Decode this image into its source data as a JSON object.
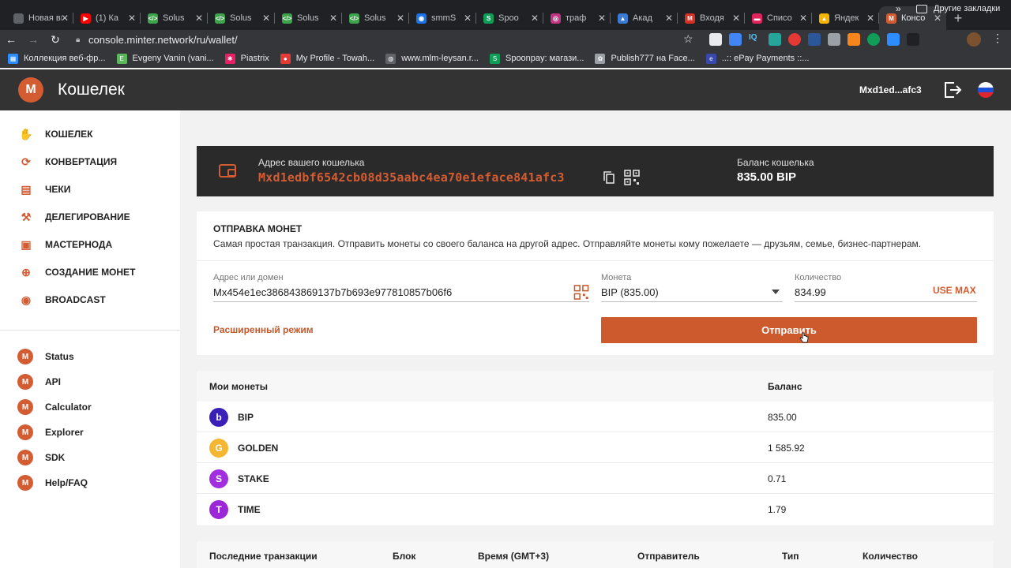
{
  "browser": {
    "tabs": [
      {
        "title": "Новая вкл",
        "color": "#5f6368",
        "glyph": ""
      },
      {
        "title": "(1) Ка",
        "color": "#ff0000",
        "glyph": "▶"
      },
      {
        "title": "Solus",
        "color": "#3fa34d",
        "glyph": "</>"
      },
      {
        "title": "Solus",
        "color": "#3fa34d",
        "glyph": "</>"
      },
      {
        "title": "Solus",
        "color": "#3fa34d",
        "glyph": "</>"
      },
      {
        "title": "Solus",
        "color": "#3fa34d",
        "glyph": "</>"
      },
      {
        "title": "smmS",
        "color": "#1a73e8",
        "glyph": "◉"
      },
      {
        "title": "Spoo",
        "color": "#0f9d58",
        "glyph": "S"
      },
      {
        "title": "траф",
        "color": "#c13584",
        "glyph": "◎"
      },
      {
        "title": "Акад",
        "color": "#3a7bd5",
        "glyph": "▲"
      },
      {
        "title": "Входя",
        "color": "#d93025",
        "glyph": "M"
      },
      {
        "title": "Списо",
        "color": "#e0245e",
        "glyph": "▬"
      },
      {
        "title": "Яндек",
        "color": "#f4b400",
        "glyph": "▲"
      },
      {
        "title": "Консо",
        "color": "#d35c32",
        "glyph": "M"
      }
    ],
    "url": "console.minter.network/ru/wallet/",
    "bookmarks": [
      {
        "label": "Коллекция веб-фр...",
        "color": "#2d8cff",
        "glyph": "▦"
      },
      {
        "label": "Evgeny Vanin (vani...",
        "color": "#5cb85c",
        "glyph": "E"
      },
      {
        "label": "Piastrix",
        "color": "#e91e63",
        "glyph": "✱"
      },
      {
        "label": "My Profile - Towah...",
        "color": "#e53935",
        "glyph": "●"
      },
      {
        "label": "www.mlm-leysan.r...",
        "color": "#5f6368",
        "glyph": "◍"
      },
      {
        "label": "Spoonpay: магази...",
        "color": "#0f9d58",
        "glyph": "S"
      },
      {
        "label": "Publish777 на Face...",
        "color": "#9aa0a6",
        "glyph": "✿"
      },
      {
        "label": "..:: ePay Payments ::...",
        "color": "#3949ab",
        "glyph": "e"
      }
    ],
    "bookmarks_more": "»",
    "bookmarks_other": "Другие закладки"
  },
  "header": {
    "logo_letter": "M",
    "title": "Кошелек",
    "address": "Mxd1ed...afc3"
  },
  "sidebar": {
    "items": [
      {
        "label": "КОШЕЛЕК",
        "icon": "wallet-hand-icon",
        "glyph": "✋"
      },
      {
        "label": "КОНВЕРТАЦИЯ",
        "icon": "convert-icon",
        "glyph": "⟳"
      },
      {
        "label": "ЧЕКИ",
        "icon": "checks-icon",
        "glyph": "▤"
      },
      {
        "label": "ДЕЛЕГИРОВАНИЕ",
        "icon": "delegate-icon",
        "glyph": "⚒"
      },
      {
        "label": "МАСТЕРНОДА",
        "icon": "masternode-icon",
        "glyph": "▣"
      },
      {
        "label": "СОЗДАНИЕ МОНЕТ",
        "icon": "create-coin-icon",
        "glyph": "⊕"
      },
      {
        "label": "BROADCAST",
        "icon": "broadcast-icon",
        "glyph": "◉"
      }
    ],
    "links": [
      {
        "label": "Status"
      },
      {
        "label": "API"
      },
      {
        "label": "Calculator"
      },
      {
        "label": "Explorer"
      },
      {
        "label": "SDK"
      },
      {
        "label": "Help/FAQ"
      }
    ]
  },
  "wallet": {
    "address_label": "Адрес вашего кошелька",
    "address": "Mxd1edbf6542cb08d35aabc4ea70e1eface841afc3",
    "balance_label": "Баланс кошелька",
    "balance": "835.00 BIP"
  },
  "send": {
    "title": "ОТПРАВКА МОНЕТ",
    "description": "Самая простая транзакция. Отправить монеты со своего баланса на другой адрес. Отправляйте монеты кому пожелаете — друзьям, семье, бизнес-партнерам.",
    "address_label": "Адрес или домен",
    "address_value": "Mx454e1ec386843869137b7b693e977810857b06f6",
    "coin_label": "Монета",
    "coin_value": "BIP (835.00)",
    "amount_label": "Количество",
    "amount_value": "834.99",
    "use_max": "USE MAX",
    "advanced": "Расширенный режим",
    "submit": "Отправить"
  },
  "coins": {
    "header_name": "Мои монеты",
    "header_balance": "Баланс",
    "rows": [
      {
        "symbol": "BIP",
        "badge": "b",
        "color": "#3a1fb8",
        "balance": "835.00"
      },
      {
        "symbol": "GOLDEN",
        "badge": "G",
        "color": "#f5b731",
        "balance": "1 585.92"
      },
      {
        "symbol": "STAKE",
        "badge": "S",
        "color": "#a12fe0",
        "balance": "0.71"
      },
      {
        "symbol": "TIME",
        "badge": "T",
        "color": "#9c27d9",
        "balance": "1.79"
      }
    ]
  },
  "transactions": {
    "headers": [
      "Последние транзакции",
      "Блок",
      "Время (GMT+3)",
      "Отправитель",
      "Тип",
      "Количество"
    ]
  }
}
